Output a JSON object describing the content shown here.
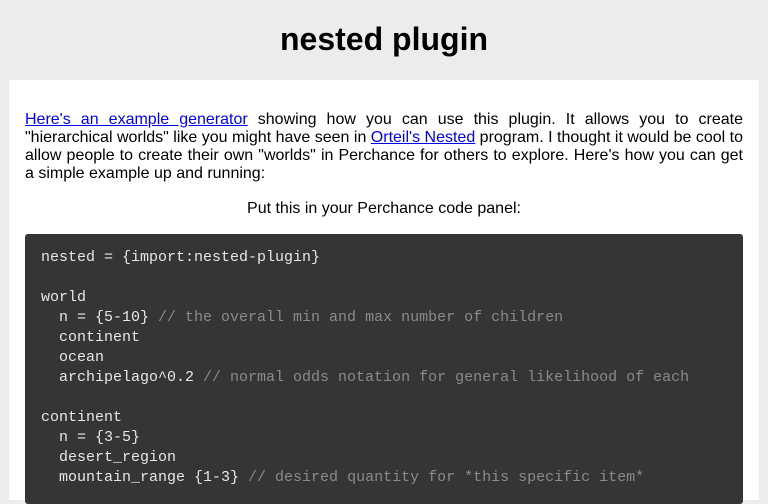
{
  "page": {
    "title": "nested plugin"
  },
  "intro": {
    "link1_text": "Here's an example generator",
    "text1": " showing how you can use this plugin. It allows you to create \"hierarchical worlds\" like you might have seen in ",
    "link2_text": "Orteil's Nested",
    "text2": " program. I thought it would be cool to allow people to create their own \"worlds\" in Perchance for others to explore. Here's how you can get a simple example up and running:"
  },
  "instruction": "Put this in your Perchance code panel:",
  "code": {
    "lines": [
      {
        "code": "nested = {import:nested-plugin}",
        "comment": ""
      },
      {
        "code": "",
        "comment": ""
      },
      {
        "code": "world",
        "comment": ""
      },
      {
        "code": "  n = {5-10} ",
        "comment": "// the overall min and max number of children"
      },
      {
        "code": "  continent",
        "comment": ""
      },
      {
        "code": "  ocean",
        "comment": ""
      },
      {
        "code": "  archipelago^0.2 ",
        "comment": "// normal odds notation for general likelihood of each"
      },
      {
        "code": "",
        "comment": ""
      },
      {
        "code": "continent",
        "comment": ""
      },
      {
        "code": "  n = {3-5}",
        "comment": ""
      },
      {
        "code": "  desert_region",
        "comment": ""
      },
      {
        "code": "  mountain_range {1-3} ",
        "comment": "// desired quantity for *this specific item*"
      }
    ]
  }
}
